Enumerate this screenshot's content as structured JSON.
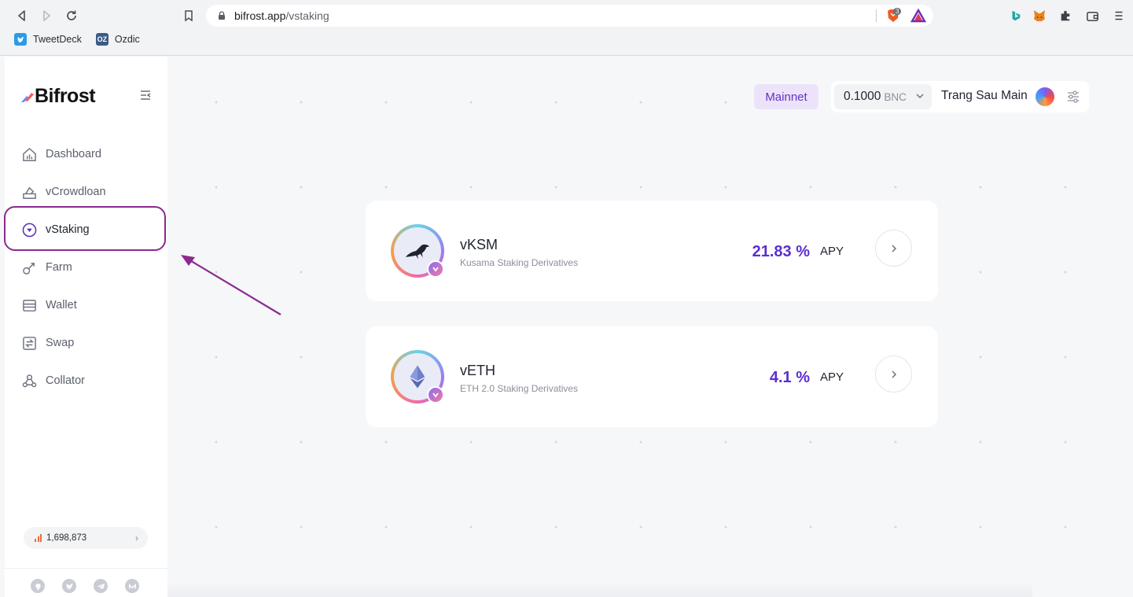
{
  "browser": {
    "url_host": "bifrost.app",
    "url_path": "/vstaking",
    "brave_badge": "3",
    "bookmarks": [
      {
        "label": "TweetDeck",
        "icon": "twitter-icon"
      },
      {
        "label": "Ozdic",
        "icon": "oz-icon",
        "icon_text": "OZ"
      }
    ]
  },
  "sidebar": {
    "logo": "Bifrost",
    "items": [
      {
        "label": "Dashboard",
        "icon": "dashboard-icon"
      },
      {
        "label": "vCrowdloan",
        "icon": "crowdloan-icon"
      },
      {
        "label": "vStaking",
        "icon": "vstaking-icon",
        "active": true
      },
      {
        "label": "Farm",
        "icon": "farm-icon"
      },
      {
        "label": "Wallet",
        "icon": "wallet-icon"
      },
      {
        "label": "Swap",
        "icon": "swap-icon"
      },
      {
        "label": "Collator",
        "icon": "collator-icon"
      }
    ],
    "block_height": "1,698,873",
    "socials": [
      "github-icon",
      "twitter-icon",
      "telegram-icon",
      "medium-icon"
    ]
  },
  "header": {
    "network": "Mainnet",
    "balance": "0.1000",
    "balance_unit": "BNC",
    "account_name": "Trang Sau Main"
  },
  "tokens": [
    {
      "name": "vKSM",
      "description": "Kusama Staking Derivatives",
      "apy": "21.83 %",
      "apy_label": "APY",
      "icon": "kusama-bird-icon"
    },
    {
      "name": "vETH",
      "description": "ETH 2.0 Staking Derivatives",
      "apy": "4.1 %",
      "apy_label": "APY",
      "icon": "ethereum-icon"
    }
  ],
  "colors": {
    "accent": "#5a2fd0",
    "annotation": "#8b2a8f",
    "mainnet_bg": "#ece3fb"
  }
}
